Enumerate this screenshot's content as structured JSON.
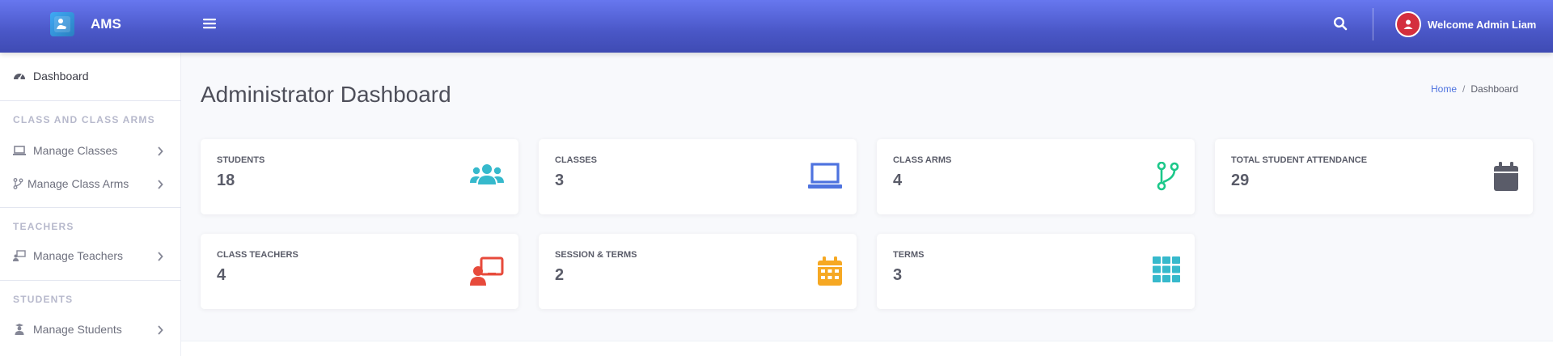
{
  "app": {
    "name": "AMS"
  },
  "topbar": {
    "welcome_text": "Welcome Admin Liam"
  },
  "sidebar": {
    "dashboard_label": "Dashboard",
    "headings": {
      "class": "CLASS AND CLASS ARMS",
      "teachers": "TEACHERS",
      "students": "STUDENTS"
    },
    "items": {
      "manage_classes": "Manage Classes",
      "manage_class_arms": "Manage Class Arms",
      "manage_teachers": "Manage Teachers",
      "manage_students": "Manage Students"
    }
  },
  "page": {
    "title": "Administrator Dashboard",
    "breadcrumb": {
      "home": "Home",
      "current": "Dashboard"
    }
  },
  "cards": {
    "students": {
      "label": "STUDENTS",
      "value": "18",
      "icon": "users-icon",
      "color": "#36b9cc"
    },
    "classes": {
      "label": "CLASSES",
      "value": "3",
      "icon": "laptop-icon",
      "color": "#4e73df"
    },
    "class_arms": {
      "label": "CLASS ARMS",
      "value": "4",
      "icon": "code-branch-icon",
      "color": "#1cc88a"
    },
    "attendance": {
      "label": "TOTAL STUDENT ATTENDANCE",
      "value": "29",
      "icon": "calendar-icon",
      "color": "#5a5c69"
    },
    "class_teachers": {
      "label": "CLASS TEACHERS",
      "value": "4",
      "icon": "chalkboard-teacher-icon",
      "color": "#e74a3b"
    },
    "sessions": {
      "label": "SESSION & TERMS",
      "value": "2",
      "icon": "calendar-alt-icon",
      "color": "#f6a823"
    },
    "terms": {
      "label": "TERMS",
      "value": "3",
      "icon": "th-icon",
      "color": "#36b9cc"
    }
  }
}
